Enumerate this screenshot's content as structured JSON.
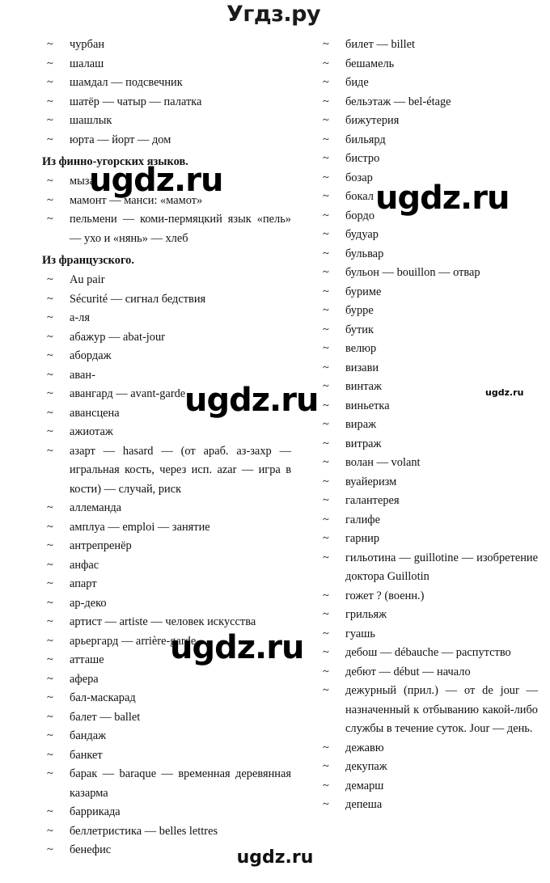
{
  "header": {
    "logo_text": "Угдз.ру"
  },
  "footer": {
    "watermark_text": "ugdz.ru"
  },
  "watermarks": {
    "large": "ugdz.ru",
    "small": "ugdz.ru"
  },
  "left_column": {
    "lead_items": [
      "чурбан",
      "шалаш",
      "шамдал — подсвечник",
      "шатёр — чатыр — палатка",
      "шашлык",
      "юрта — йорт — дом"
    ],
    "sections": [
      {
        "heading": "Из финно-угорских языков.",
        "items": [
          "мыза",
          "мамонт — манси: «мамот»",
          "пельмени — коми-пермяцкий язык «пель» — ухо и «нянь» — хлеб"
        ]
      },
      {
        "heading": "Из французского.",
        "items": [
          "Au pair",
          "Sécurité — сигнал бедствия",
          "а-ля",
          "абажур — abat-jour",
          "абордаж",
          "аван-",
          "авангард — avant-garde",
          "авансцена",
          "ажиотаж",
          "азарт — hasard — (от араб. аз-захр — игральная кость, через исп. azar — игра в кости) — случай, риск",
          "аллеманда",
          "амплуа — emploi — занятие",
          "антрепренёр",
          "анфас",
          "апарт",
          "ар-деко",
          "артист — artiste — человек искусства",
          "арьергард — arrière-garde",
          "атташе",
          "афера",
          "бал-маскарад",
          "балет — ballet",
          "бандаж",
          "банкет",
          "барак — baraque — временная деревянная казарма",
          "баррикада",
          "беллетристика — belles lettres",
          "бенефис"
        ]
      }
    ]
  },
  "right_column": {
    "items": [
      "билет — billet",
      "бешамель",
      "биде",
      "бельэтаж — bel-étage",
      "бижутерия",
      "бильярд",
      "бистро",
      "бозар",
      "бокал",
      "бордо",
      "будуар",
      "бульвар",
      "бульон — bouillon — отвар",
      "буриме",
      "бурре",
      "бутик",
      "велюр",
      "визави",
      "винтаж",
      "виньетка",
      "вираж",
      "витраж",
      "волан — volant",
      "вуайеризм",
      "галантерея",
      "галифе",
      "гарнир",
      "гильотина — guillotine — изобретение доктора Guillotin",
      "гожет ? (военн.)",
      "грильяж",
      "гуашь",
      "дебош — débauche — распутство",
      "дебют — début — начало",
      "дежурный (прил.) — от de jour — назначенный к отбыванию какой-либо службы в течение суток. Jour — день.",
      "дежавю",
      "декупаж",
      "демарш",
      "депеша"
    ],
    "justified_indices": [
      27,
      33
    ]
  },
  "left_justified_indices": {
    "french": [
      9,
      16,
      24
    ]
  },
  "tilde_glyph": "~"
}
